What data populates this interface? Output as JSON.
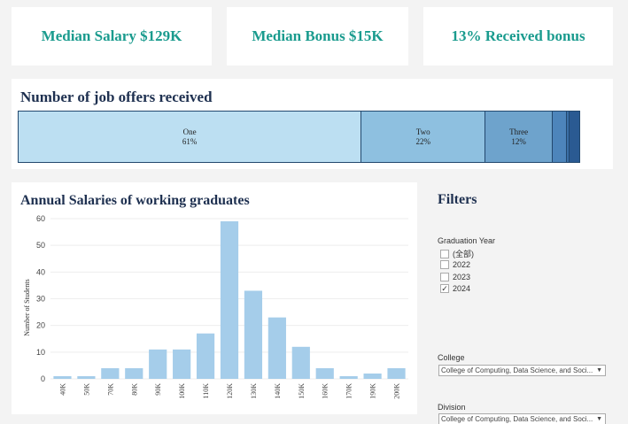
{
  "kpis": {
    "median_salary": "Median Salary $129K",
    "median_bonus": "Median Bonus $15K",
    "received_bonus": "13% Received bonus"
  },
  "offers": {
    "title": "Number of job offers received",
    "segments": [
      {
        "label": "One",
        "pct_label": "61%",
        "share": 0.61,
        "color": "#bcdff2"
      },
      {
        "label": "Two",
        "pct_label": "22%",
        "share": 0.22,
        "color": "#8ec0e0"
      },
      {
        "label": "Three",
        "pct_label": "12%",
        "share": 0.12,
        "color": "#6ea3cc"
      },
      {
        "label": "",
        "pct_label": "",
        "share": 0.025,
        "color": "#4d85bb"
      },
      {
        "label": "",
        "pct_label": "",
        "share": 0.005,
        "color": "#3a6fa6"
      },
      {
        "label": "",
        "pct_label": "",
        "share": 0.02,
        "color": "#2a5a92"
      }
    ]
  },
  "salary_chart": {
    "title": "Annual Salaries of working graduates"
  },
  "chart_data": {
    "type": "bar",
    "title": "Annual Salaries of working graduates",
    "xlabel": "",
    "ylabel": "Number of Students",
    "categories": [
      "40K",
      "50K",
      "70K",
      "80K",
      "90K",
      "100K",
      "110K",
      "120K",
      "130K",
      "140K",
      "150K",
      "160K",
      "170K",
      "190K",
      "200K"
    ],
    "values": [
      1,
      1,
      4,
      4,
      11,
      11,
      17,
      59,
      33,
      23,
      12,
      4,
      1,
      2,
      4
    ],
    "ylim": [
      0,
      60
    ],
    "yticks": [
      0,
      10,
      20,
      30,
      40,
      50,
      60
    ],
    "bar_color": "#a5cdea",
    "grid": true
  },
  "filters": {
    "title": "Filters",
    "graduation_year": {
      "label": "Graduation Year",
      "options": [
        {
          "label": "(全部)",
          "checked": false
        },
        {
          "label": "2022",
          "checked": false
        },
        {
          "label": "2023",
          "checked": false
        },
        {
          "label": "2024",
          "checked": true
        }
      ]
    },
    "college": {
      "label": "College",
      "value": "College of Computing, Data Science, and Soci..."
    },
    "division": {
      "label": "Division",
      "value": "College of Computing, Data Science, and Soci..."
    }
  }
}
